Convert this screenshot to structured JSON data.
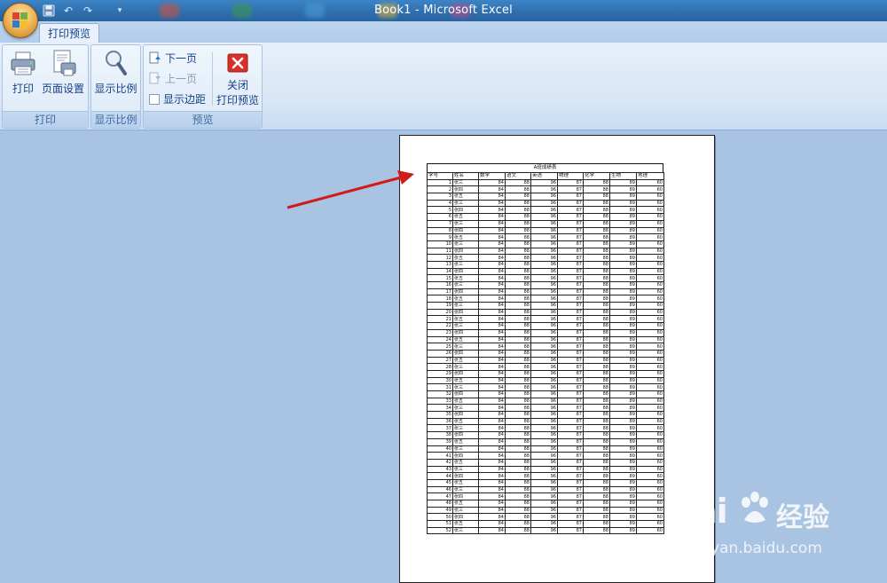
{
  "window": {
    "title": "Book1 - Microsoft Excel"
  },
  "quick_access": {
    "save_icon": "save-icon",
    "undo_icon": "undo-icon",
    "redo_icon": "redo-icon",
    "customize_icon": "customize-qat-icon"
  },
  "ribbon": {
    "active_tab": "打印预览",
    "groups": [
      {
        "label": "打印"
      },
      {
        "label": "显示比例"
      },
      {
        "label": "预览"
      }
    ],
    "print_label": "打印",
    "page_setup_label": "页面设置",
    "zoom_label": "显示比例",
    "next_page_label": "下一页",
    "prev_page_label": "上一页",
    "show_margins_label": "显示边距",
    "close_label_line1": "关闭",
    "close_label_line2": "打印预览"
  },
  "sheet": {
    "title": "A班成绩表",
    "headers": [
      "学号",
      "姓名",
      "数学",
      "语文",
      "英语",
      "物理",
      "化学",
      "生物",
      "地理"
    ],
    "rows": [
      [
        "1",
        "张三",
        "84",
        "88",
        "96",
        "87",
        "88",
        "89",
        "60"
      ],
      [
        "2",
        "张四",
        "84",
        "88",
        "96",
        "87",
        "88",
        "89",
        "60"
      ],
      [
        "3",
        "张五",
        "84",
        "88",
        "96",
        "87",
        "88",
        "89",
        "60"
      ],
      [
        "4",
        "张三",
        "84",
        "88",
        "96",
        "87",
        "88",
        "89",
        "60"
      ],
      [
        "5",
        "张四",
        "84",
        "88",
        "96",
        "87",
        "88",
        "89",
        "60"
      ],
      [
        "6",
        "张五",
        "84",
        "88",
        "96",
        "87",
        "88",
        "89",
        "60"
      ],
      [
        "7",
        "张三",
        "84",
        "88",
        "96",
        "87",
        "88",
        "89",
        "60"
      ],
      [
        "8",
        "张四",
        "84",
        "88",
        "96",
        "87",
        "88",
        "89",
        "60"
      ],
      [
        "9",
        "张五",
        "84",
        "88",
        "96",
        "87",
        "88",
        "89",
        "60"
      ],
      [
        "10",
        "张三",
        "84",
        "88",
        "96",
        "87",
        "88",
        "89",
        "60"
      ],
      [
        "11",
        "张四",
        "84",
        "88",
        "96",
        "87",
        "88",
        "89",
        "60"
      ],
      [
        "12",
        "张五",
        "84",
        "88",
        "96",
        "87",
        "88",
        "89",
        "60"
      ],
      [
        "13",
        "张三",
        "84",
        "88",
        "96",
        "87",
        "88",
        "89",
        "60"
      ],
      [
        "14",
        "张四",
        "84",
        "88",
        "96",
        "87",
        "88",
        "89",
        "60"
      ],
      [
        "15",
        "张五",
        "84",
        "88",
        "96",
        "87",
        "88",
        "89",
        "60"
      ],
      [
        "16",
        "张三",
        "84",
        "88",
        "96",
        "87",
        "88",
        "89",
        "60"
      ],
      [
        "17",
        "张四",
        "84",
        "88",
        "96",
        "87",
        "88",
        "89",
        "60"
      ],
      [
        "18",
        "张五",
        "84",
        "88",
        "96",
        "87",
        "88",
        "89",
        "60"
      ],
      [
        "19",
        "张三",
        "84",
        "88",
        "96",
        "87",
        "88",
        "89",
        "60"
      ],
      [
        "20",
        "张四",
        "84",
        "88",
        "96",
        "87",
        "88",
        "89",
        "60"
      ],
      [
        "21",
        "张五",
        "84",
        "88",
        "96",
        "87",
        "88",
        "89",
        "60"
      ],
      [
        "22",
        "张三",
        "84",
        "88",
        "96",
        "87",
        "88",
        "89",
        "60"
      ],
      [
        "23",
        "张四",
        "84",
        "88",
        "96",
        "87",
        "88",
        "89",
        "60"
      ],
      [
        "24",
        "张五",
        "84",
        "88",
        "96",
        "87",
        "88",
        "89",
        "60"
      ],
      [
        "25",
        "张三",
        "84",
        "88",
        "96",
        "87",
        "88",
        "89",
        "60"
      ],
      [
        "26",
        "张四",
        "84",
        "88",
        "96",
        "87",
        "88",
        "89",
        "60"
      ],
      [
        "27",
        "张五",
        "84",
        "88",
        "96",
        "87",
        "88",
        "89",
        "60"
      ],
      [
        "28",
        "张三",
        "84",
        "88",
        "96",
        "87",
        "88",
        "89",
        "60"
      ],
      [
        "29",
        "张四",
        "84",
        "88",
        "96",
        "87",
        "88",
        "89",
        "60"
      ],
      [
        "30",
        "张五",
        "84",
        "88",
        "96",
        "87",
        "88",
        "89",
        "60"
      ],
      [
        "31",
        "张三",
        "84",
        "88",
        "96",
        "87",
        "88",
        "89",
        "60"
      ],
      [
        "32",
        "张四",
        "84",
        "88",
        "96",
        "87",
        "88",
        "89",
        "60"
      ],
      [
        "33",
        "张五",
        "84",
        "88",
        "96",
        "87",
        "88",
        "89",
        "60"
      ],
      [
        "34",
        "张三",
        "84",
        "88",
        "96",
        "87",
        "88",
        "89",
        "60"
      ],
      [
        "35",
        "张四",
        "84",
        "88",
        "96",
        "87",
        "88",
        "89",
        "60"
      ],
      [
        "36",
        "张五",
        "84",
        "88",
        "96",
        "87",
        "88",
        "89",
        "60"
      ],
      [
        "37",
        "张三",
        "84",
        "88",
        "96",
        "87",
        "88",
        "89",
        "60"
      ],
      [
        "38",
        "张四",
        "84",
        "88",
        "96",
        "87",
        "88",
        "89",
        "60"
      ],
      [
        "39",
        "张五",
        "84",
        "88",
        "96",
        "87",
        "88",
        "89",
        "60"
      ],
      [
        "40",
        "张三",
        "84",
        "88",
        "96",
        "87",
        "88",
        "89",
        "60"
      ],
      [
        "41",
        "张四",
        "84",
        "88",
        "96",
        "87",
        "88",
        "89",
        "60"
      ],
      [
        "42",
        "张五",
        "84",
        "88",
        "96",
        "87",
        "88",
        "89",
        "60"
      ],
      [
        "43",
        "张三",
        "84",
        "88",
        "96",
        "87",
        "88",
        "89",
        "60"
      ],
      [
        "44",
        "张四",
        "84",
        "88",
        "96",
        "87",
        "88",
        "89",
        "60"
      ],
      [
        "45",
        "张五",
        "84",
        "88",
        "96",
        "87",
        "88",
        "89",
        "60"
      ],
      [
        "46",
        "张三",
        "84",
        "88",
        "96",
        "87",
        "88",
        "89",
        "60"
      ],
      [
        "47",
        "张四",
        "84",
        "88",
        "96",
        "87",
        "88",
        "89",
        "60"
      ],
      [
        "48",
        "张五",
        "84",
        "88",
        "96",
        "87",
        "88",
        "89",
        "60"
      ],
      [
        "49",
        "张三",
        "84",
        "88",
        "96",
        "87",
        "88",
        "89",
        "60"
      ],
      [
        "50",
        "张四",
        "84",
        "88",
        "96",
        "87",
        "88",
        "89",
        "60"
      ],
      [
        "51",
        "张五",
        "84",
        "88",
        "96",
        "87",
        "88",
        "89",
        "60"
      ],
      [
        "52",
        "张三",
        "84",
        "88",
        "96",
        "87",
        "88",
        "89",
        "60"
      ]
    ]
  },
  "watermark": {
    "logo_text": "Bai",
    "logo_suffix": "经验",
    "url": "jingyan.baidu.com"
  },
  "colors": {
    "title_bar": "#2f6fae",
    "ribbon_text": "#15428b",
    "workspace": "#a9c3e3",
    "arrow": "#d21a1a",
    "close_icon": "#d9302a"
  }
}
